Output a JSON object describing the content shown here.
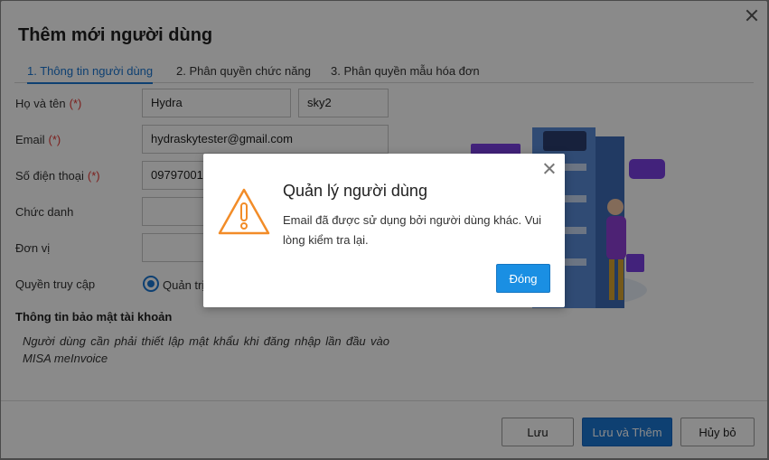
{
  "dialog": {
    "title": "Thêm mới người dùng"
  },
  "tabs": [
    {
      "label": "1. Thông tin người dùng",
      "active": true
    },
    {
      "label": "2. Phân quyền chức năng",
      "active": false
    },
    {
      "label": "3. Phân quyền mẫu hóa đơn",
      "active": false
    }
  ],
  "form": {
    "required_mark": "(*)",
    "full_name_label": "Họ và tên",
    "first_name_value": "Hydra",
    "last_name_value": "sky2",
    "email_label": "Email",
    "email_value": "hydraskytester@gmail.com",
    "phone_label": "Số điện thoại",
    "phone_value": "09797001",
    "position_label": "Chức danh",
    "position_value": "",
    "unit_label": "Đơn vị",
    "unit_value": "",
    "access_label": "Quyền truy cập",
    "access_option_admin": "Quản trị",
    "security_title": "Thông tin bảo mật tài khoản",
    "security_note": "Người dùng cần phải thiết lập mật khẩu khi đăng nhập lần đầu vào MISA meInvoice"
  },
  "footer": {
    "save_label": "Lưu",
    "save_add_label": "Lưu và Thêm",
    "cancel_label": "Hủy bỏ"
  },
  "alert": {
    "title": "Quản lý người dùng",
    "message": "Email đã được sử dụng bởi người dùng khác. Vui lòng kiểm tra lại.",
    "close_label": "Đóng",
    "icon": "warning-triangle-icon"
  },
  "colors": {
    "primary": "#1a76d2",
    "required": "#e53935",
    "warning": "#f28c28",
    "alert_button": "#1a8fe3"
  }
}
